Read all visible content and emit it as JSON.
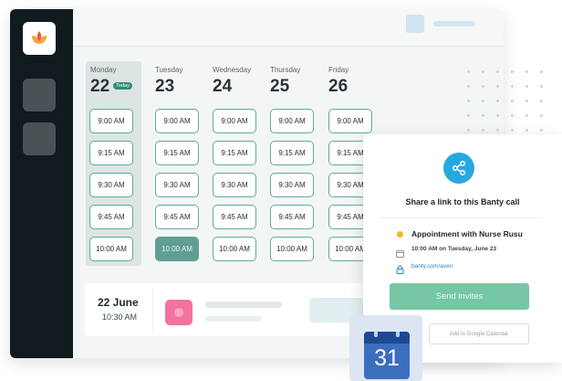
{
  "app": {
    "logo": "lotus-logo-icon"
  },
  "schedule": {
    "days": [
      {
        "name": "Monday",
        "number": "22",
        "badge": "Today",
        "slots": [
          "9:00 AM",
          "9:15 AM",
          "9:30 AM",
          "9:45 AM",
          "10:00 AM"
        ]
      },
      {
        "name": "Tuesday",
        "number": "23",
        "slots": [
          "9:00 AM",
          "9:15 AM",
          "9:30 AM",
          "9:45 AM",
          "10:00 AM"
        ],
        "selected_slot": "10:00 AM"
      },
      {
        "name": "Wednesday",
        "number": "24",
        "slots": [
          "9:00 AM",
          "9:15 AM",
          "9:30 AM",
          "9:45 AM",
          "10:00 AM"
        ]
      },
      {
        "name": "Thursday",
        "number": "25",
        "slots": [
          "9:00 AM",
          "9:15 AM",
          "9:30 AM",
          "9:45 AM",
          "10:00 AM"
        ]
      },
      {
        "name": "Friday",
        "number": "26",
        "slots": [
          "9:00 AM",
          "9:15 AM",
          "9:30 AM",
          "9:45 AM",
          "10:00 AM"
        ]
      }
    ]
  },
  "upcoming": {
    "date": "22 June",
    "time": "10:30 AM"
  },
  "share_panel": {
    "icon": "share-icon",
    "title": "Share a link to this Banty call",
    "appointment": "Appointment with Nurse Rusu",
    "datetime": "10:00 AM on Tuesday, June 23",
    "link": "banty.com/aven",
    "send_label": "Send invites",
    "gcal_label": "Add to Google Calendar"
  },
  "calendar_icon": {
    "day": "31"
  },
  "colors": {
    "sidebar": "#111b1f",
    "slot_border": "#5faa98",
    "selected_slot": "#5e9f91",
    "share_accent": "#26a9e0",
    "send_button": "#76c7a5",
    "status_dot": "#f5b727",
    "link": "#2f7ec4"
  }
}
